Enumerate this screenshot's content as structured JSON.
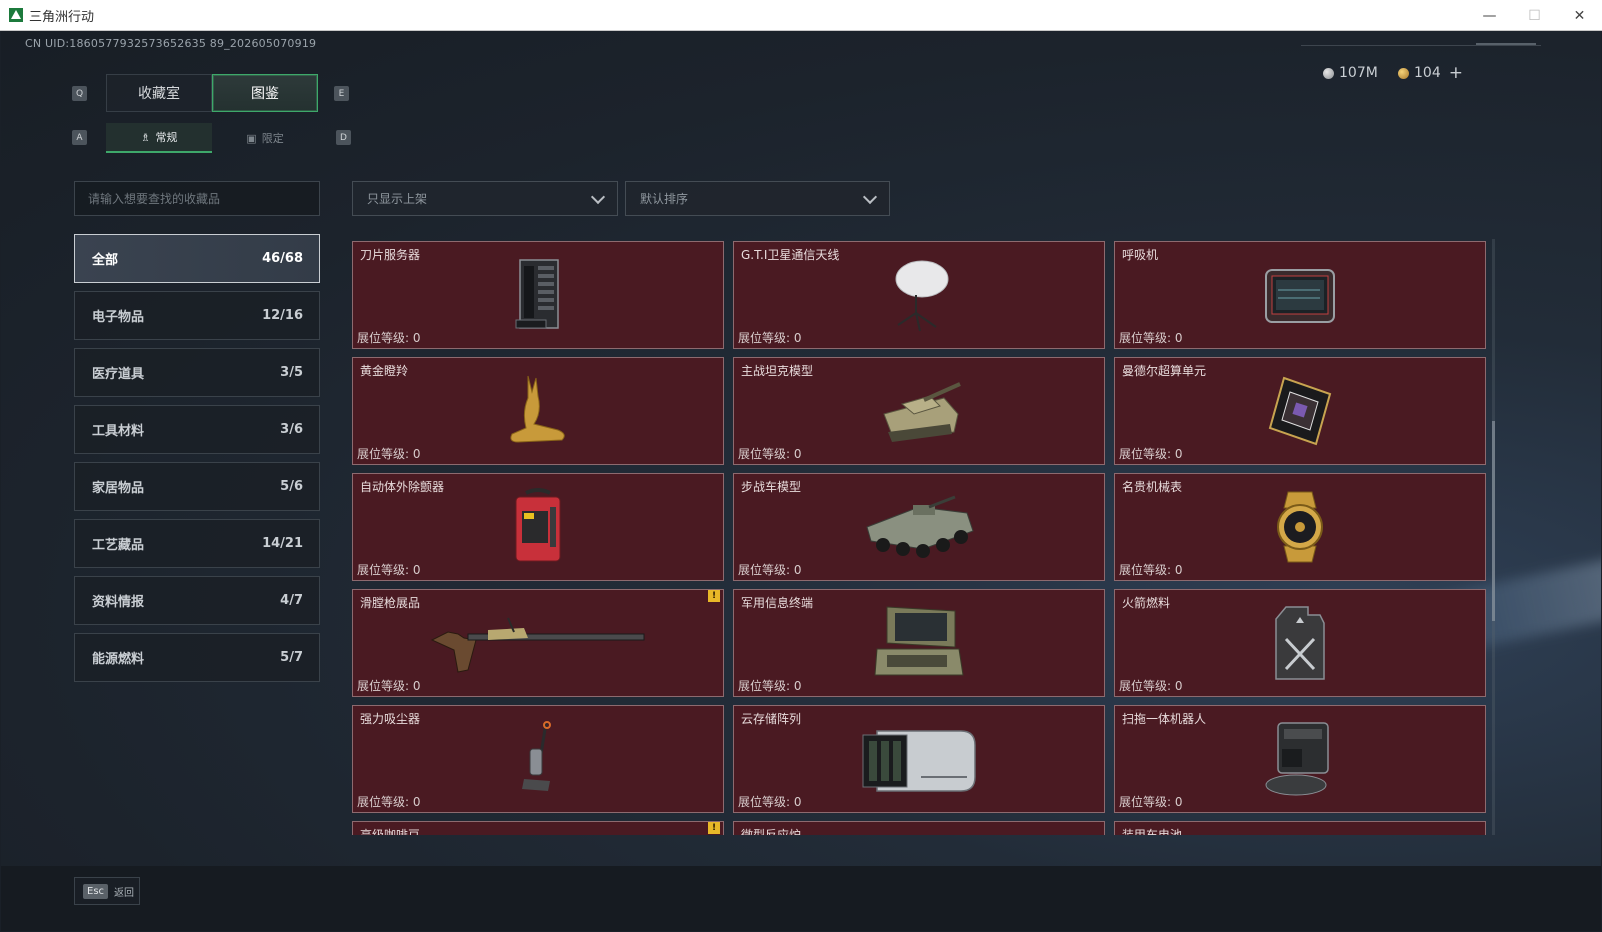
{
  "window": {
    "title": "三角洲行动",
    "minimize": "—",
    "maximize": "☐",
    "close": "✕"
  },
  "uid": "CN UID:1860577932573652635 89_202605070919",
  "currency": {
    "silver": "107M",
    "gold": "104",
    "add": "+"
  },
  "keys": {
    "q": "Q",
    "e": "E",
    "a": "A",
    "d": "D"
  },
  "tabs": {
    "collection_room": "收藏室",
    "catalog": "图鉴"
  },
  "subtabs": {
    "regular": "常规",
    "limited": "限定"
  },
  "search": {
    "placeholder": "请输入想要查找的收藏品"
  },
  "filters": {
    "shelf": "只显示上架",
    "sort": "默认排序"
  },
  "categories": [
    {
      "label": "全部",
      "count": "46/68"
    },
    {
      "label": "电子物品",
      "count": "12/16"
    },
    {
      "label": "医疗道具",
      "count": "3/5"
    },
    {
      "label": "工具材料",
      "count": "3/6"
    },
    {
      "label": "家居物品",
      "count": "5/6"
    },
    {
      "label": "工艺藏品",
      "count": "14/21"
    },
    {
      "label": "资料情报",
      "count": "4/7"
    },
    {
      "label": "能源燃料",
      "count": "5/7"
    }
  ],
  "level_label": "展位等级:",
  "items": [
    {
      "name": "刀片服务器",
      "level": "0",
      "icon": "blade-server-icon"
    },
    {
      "name": "G.T.I卫星通信天线",
      "level": "0",
      "icon": "satellite-dish-icon"
    },
    {
      "name": "呼吸机",
      "level": "0",
      "icon": "ventilator-icon"
    },
    {
      "name": "黄金瞪羚",
      "level": "0",
      "icon": "golden-gazelle-icon"
    },
    {
      "name": "主战坦克模型",
      "level": "0",
      "icon": "tank-model-icon"
    },
    {
      "name": "曼德尔超算单元",
      "level": "0",
      "icon": "supercomputer-unit-icon"
    },
    {
      "name": "自动体外除颤器",
      "level": "0",
      "icon": "defibrillator-icon"
    },
    {
      "name": "步战车模型",
      "level": "0",
      "icon": "ifv-model-icon"
    },
    {
      "name": "名贵机械表",
      "level": "0",
      "icon": "luxury-watch-icon"
    },
    {
      "name": "滑膛枪展品",
      "level": "0",
      "icon": "musket-icon",
      "warn": "!"
    },
    {
      "name": "军用信息终端",
      "level": "0",
      "icon": "military-terminal-icon"
    },
    {
      "name": "火箭燃料",
      "level": "0",
      "icon": "rocket-fuel-icon"
    },
    {
      "name": "强力吸尘器",
      "level": "0",
      "icon": "vacuum-cleaner-icon"
    },
    {
      "name": "云存储阵列",
      "level": "0",
      "icon": "cloud-storage-icon"
    },
    {
      "name": "扫拖一体机器人",
      "level": "0",
      "icon": "mop-robot-icon"
    }
  ],
  "partial_items": [
    {
      "name": "高级咖啡豆",
      "warn": "!"
    },
    {
      "name": "微型反应炉"
    },
    {
      "name": "装甲车电池"
    }
  ],
  "footer": {
    "esc_key": "Esc",
    "back": "返回"
  },
  "colors": {
    "accent": "#3ea86a",
    "card_bg": "#4a1a22",
    "card_border": "#8d6a6f",
    "warning": "#e8b828"
  }
}
